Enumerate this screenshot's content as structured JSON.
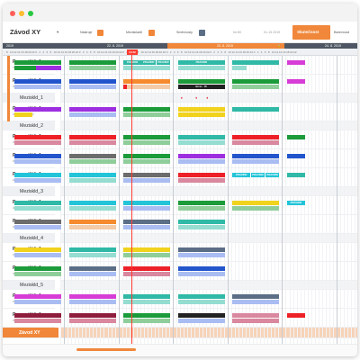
{
  "colors": {
    "accent": "#f0873a",
    "green": "#1b9b3a",
    "lightgreen": "#8fce9a",
    "blue": "#2255cc",
    "lightblue": "#a9bdf2",
    "purple": "#9d2fe0",
    "magenta": "#d63dd6",
    "teal": "#2fb9a6",
    "lightteal": "#95dcd1",
    "cyan": "#23c4d8",
    "red": "#ee2027",
    "yellow": "#f1d21d",
    "gray": "#6c6c6c",
    "slate": "#5b6e86",
    "maroon": "#8e1c3d",
    "pink": "#d9889f",
    "orange": "#f58b2e",
    "lightorange": "#f3cba8",
    "black": "#222222",
    "now": "#ff3b30"
  },
  "window": {
    "controls": [
      "close",
      "minimize",
      "zoom"
    ]
  },
  "toolbar": {
    "title": "Závod XY",
    "caret": "▾",
    "legend": [
      {
        "label": "Nástroje",
        "color": "#f0873a"
      },
      {
        "label": "Meziskladů",
        "color": "#f0873a"
      },
      {
        "label": "Směnnosty",
        "color": "#5b6e86"
      }
    ],
    "view_week": "Im:60",
    "view_range": "01-15 2019",
    "active_tab": "Skutečnost",
    "inactive_tab": "Barevnost"
  },
  "timeline": {
    "year": "2019",
    "dates": [
      "22. 8. 2019",
      "23. 8. 2019",
      "24. 8. 2019"
    ],
    "lock_icon": "🔒",
    "now_label": "14:42",
    "day_ticks": [
      "8",
      "10",
      "12",
      "14",
      "16",
      "18",
      "20",
      "22",
      "0",
      "2",
      "4",
      "6",
      "8",
      "10",
      "12",
      "14",
      "16",
      "18",
      "20",
      "22",
      "0",
      "2",
      "4",
      "6",
      "8",
      "10",
      "12",
      "14",
      "16",
      "18",
      "20",
      "22",
      "0",
      "2",
      "4",
      "6",
      "8",
      "10",
      "12",
      "14",
      "16",
      "18",
      "20",
      "22",
      "0",
      "2",
      "4",
      "6",
      "8",
      "10",
      "12",
      "14",
      "16",
      "18",
      "20",
      "22",
      "0",
      "2",
      "4",
      "6",
      "8",
      "10",
      "12",
      "14",
      "16",
      "18",
      "20",
      "22",
      "0",
      "2",
      "4",
      "6",
      "8",
      "10",
      "12",
      "14",
      "16",
      "18",
      "20",
      "22"
    ]
  },
  "rows": [
    {
      "name": "Pracoviště_1",
      "sub": "Motor 1 · Linka 4380",
      "type": "work",
      "accent": true
    },
    {
      "name": "Pracoviště_1",
      "sub": "Motor 1 · Linka 4380",
      "type": "work",
      "accent": true
    },
    {
      "name": "Meziskld_1",
      "sub": "",
      "type": "buffer",
      "accent": true
    },
    {
      "name": "Pracoviště_1",
      "sub": "Motor 1 · Linka 4380",
      "type": "work",
      "accent": true
    },
    {
      "name": "Meziskld_2",
      "sub": "",
      "type": "buffer",
      "accent": false
    },
    {
      "name": "Pracoviště_1",
      "sub": "Motor 1 · Linka 4380",
      "type": "work",
      "accent": false
    },
    {
      "name": "Pracoviště_1",
      "sub": "Motor 1 · Linka 4380",
      "type": "work",
      "accent": false
    },
    {
      "name": "Pracoviště_1",
      "sub": "Motor 1 · Linka 4380",
      "type": "work",
      "accent": false
    },
    {
      "name": "Meziskld_3",
      "sub": "",
      "type": "buffer",
      "accent": false
    },
    {
      "name": "Pracoviště_1",
      "sub": "Motor 1 · Linka 4380",
      "type": "work",
      "accent": false
    },
    {
      "name": "Pracoviště_1",
      "sub": "Motor 1 · Linka 4380",
      "type": "work",
      "accent": false
    },
    {
      "name": "Meziskld_4",
      "sub": "",
      "type": "buffer",
      "accent": false
    },
    {
      "name": "Pracoviště_1",
      "sub": "Motor 1 · Linka 4380",
      "type": "work",
      "accent": false
    },
    {
      "name": "Pracoviště_1",
      "sub": "Motor 1 · Linka 4380",
      "type": "work",
      "accent": false
    },
    {
      "name": "Meziskld_5",
      "sub": "",
      "type": "buffer",
      "accent": false
    },
    {
      "name": "Pracoviště_1",
      "sub": "Motor 1 · Linka 4380",
      "type": "work",
      "accent": false
    },
    {
      "name": "Pracoviště_1",
      "sub": "Motor 1 · Linka 4380",
      "type": "work",
      "accent": false
    },
    {
      "name": "Závod XY",
      "sub": "",
      "type": "plant",
      "accent": false
    }
  ],
  "bars": [
    {
      "row": 0,
      "start": 2,
      "end": 15,
      "lane": 0,
      "color": "green"
    },
    {
      "row": 0,
      "start": 2,
      "end": 8,
      "lane": 1,
      "color": "green"
    },
    {
      "row": 0,
      "start": 8,
      "end": 15,
      "lane": 1,
      "color": "purple"
    },
    {
      "row": 0,
      "start": 17,
      "end": 30,
      "lane": 0,
      "color": "green"
    },
    {
      "row": 0,
      "start": 17,
      "end": 30,
      "lane": 1,
      "color": "lightgreen"
    },
    {
      "row": 0,
      "start": 32,
      "end": 37,
      "lane": 0,
      "color": "teal",
      "label": "PRAVIDR"
    },
    {
      "row": 0,
      "start": 37,
      "end": 41,
      "lane": 0,
      "color": "teal",
      "label": "PRAVIDR"
    },
    {
      "row": 0,
      "start": 41,
      "end": 45,
      "lane": 0,
      "color": "teal",
      "label": "PRAVIDR"
    },
    {
      "row": 0,
      "start": 32,
      "end": 45,
      "lane": 1,
      "color": "lightteal"
    },
    {
      "row": 0,
      "start": 47,
      "end": 60,
      "lane": 0,
      "color": "teal",
      "label": "PRAVIDR"
    },
    {
      "row": 0,
      "start": 47,
      "end": 60,
      "lane": 1,
      "color": "lightteal"
    },
    {
      "row": 0,
      "start": 62,
      "end": 75,
      "lane": 0,
      "color": "teal"
    },
    {
      "row": 0,
      "start": 62,
      "end": 66,
      "lane": 1,
      "color": "lightteal"
    },
    {
      "row": 0,
      "start": 77,
      "end": 82,
      "lane": 0,
      "color": "magenta"
    },
    {
      "row": 1,
      "start": 2,
      "end": 15,
      "lane": 0,
      "color": "blue"
    },
    {
      "row": 1,
      "start": 2,
      "end": 15,
      "lane": 1,
      "color": "lightblue"
    },
    {
      "row": 1,
      "start": 17,
      "end": 30,
      "lane": 0,
      "color": "blue"
    },
    {
      "row": 1,
      "start": 17,
      "end": 30,
      "lane": 1,
      "color": "lightblue"
    },
    {
      "row": 1,
      "start": 32,
      "end": 45,
      "lane": 0,
      "color": "orange"
    },
    {
      "row": 1,
      "start": 32,
      "end": 33,
      "lane": 1,
      "color": "red"
    },
    {
      "row": 1,
      "start": 33,
      "end": 45,
      "lane": 1,
      "color": "lightorange"
    },
    {
      "row": 1,
      "start": 47,
      "end": 60,
      "lane": 0,
      "color": "green"
    },
    {
      "row": 1,
      "start": 47,
      "end": 60,
      "lane": 1,
      "color": "black",
      "label": "Error - 7h"
    },
    {
      "row": 1,
      "start": 62,
      "end": 75,
      "lane": 0,
      "color": "green"
    },
    {
      "row": 1,
      "start": 62,
      "end": 75,
      "lane": 1,
      "color": "lightgreen"
    },
    {
      "row": 1,
      "start": 77,
      "end": 82,
      "lane": 0,
      "color": "magenta"
    },
    {
      "row": 3,
      "start": 2,
      "end": 15,
      "lane": 0,
      "color": "purple"
    },
    {
      "row": 3,
      "start": 2,
      "end": 7,
      "lane": 1,
      "color": "yellow"
    },
    {
      "row": 3,
      "start": 17,
      "end": 30,
      "lane": 0,
      "color": "purple"
    },
    {
      "row": 3,
      "start": 17,
      "end": 30,
      "lane": 1,
      "color": "lightblue"
    },
    {
      "row": 3,
      "start": 32,
      "end": 45,
      "lane": 0,
      "color": "green"
    },
    {
      "row": 3,
      "start": 32,
      "end": 45,
      "lane": 1,
      "color": "lightgreen"
    },
    {
      "row": 3,
      "start": 47,
      "end": 60,
      "lane": 0,
      "color": "yellow"
    },
    {
      "row": 3,
      "start": 47,
      "end": 60,
      "lane": 1,
      "color": "yellow"
    },
    {
      "row": 3,
      "start": 62,
      "end": 75,
      "lane": 0,
      "color": "teal"
    },
    {
      "row": 5,
      "start": 2,
      "end": 15,
      "lane": 0,
      "color": "red"
    },
    {
      "row": 5,
      "start": 2,
      "end": 15,
      "lane": 1,
      "color": "pink"
    },
    {
      "row": 5,
      "start": 17,
      "end": 30,
      "lane": 0,
      "color": "red"
    },
    {
      "row": 5,
      "start": 17,
      "end": 30,
      "lane": 1,
      "color": "pink"
    },
    {
      "row": 5,
      "start": 32,
      "end": 45,
      "lane": 0,
      "color": "green"
    },
    {
      "row": 5,
      "start": 32,
      "end": 45,
      "lane": 1,
      "color": "lightgreen"
    },
    {
      "row": 5,
      "start": 47,
      "end": 60,
      "lane": 0,
      "color": "teal"
    },
    {
      "row": 5,
      "start": 47,
      "end": 60,
      "lane": 1,
      "color": "lightteal"
    },
    {
      "row": 5,
      "start": 62,
      "end": 75,
      "lane": 0,
      "color": "red"
    },
    {
      "row": 5,
      "start": 62,
      "end": 75,
      "lane": 1,
      "color": "pink"
    },
    {
      "row": 5,
      "start": 77,
      "end": 82,
      "lane": 0,
      "color": "green"
    },
    {
      "row": 6,
      "start": 2,
      "end": 15,
      "lane": 0,
      "color": "blue"
    },
    {
      "row": 6,
      "start": 2,
      "end": 15,
      "lane": 1,
      "color": "lightblue"
    },
    {
      "row": 6,
      "start": 17,
      "end": 30,
      "lane": 0,
      "color": "gray"
    },
    {
      "row": 6,
      "start": 17,
      "end": 30,
      "lane": 1,
      "color": "lightgreen"
    },
    {
      "row": 6,
      "start": 32,
      "end": 45,
      "lane": 0,
      "color": "green"
    },
    {
      "row": 6,
      "start": 32,
      "end": 45,
      "lane": 1,
      "color": "lightgreen"
    },
    {
      "row": 6,
      "start": 47,
      "end": 60,
      "lane": 0,
      "color": "purple"
    },
    {
      "row": 6,
      "start": 47,
      "end": 60,
      "lane": 1,
      "color": "lightblue"
    },
    {
      "row": 6,
      "start": 62,
      "end": 75,
      "lane": 0,
      "color": "blue"
    },
    {
      "row": 6,
      "start": 62,
      "end": 75,
      "lane": 1,
      "color": "lightblue"
    },
    {
      "row": 6,
      "start": 77,
      "end": 82,
      "lane": 0,
      "color": "blue"
    },
    {
      "row": 7,
      "start": 2,
      "end": 15,
      "lane": 0,
      "color": "cyan"
    },
    {
      "row": 7,
      "start": 2,
      "end": 15,
      "lane": 1,
      "color": "lightblue"
    },
    {
      "row": 7,
      "start": 17,
      "end": 30,
      "lane": 0,
      "color": "cyan"
    },
    {
      "row": 7,
      "start": 17,
      "end": 30,
      "lane": 1,
      "color": "lightteal"
    },
    {
      "row": 7,
      "start": 32,
      "end": 45,
      "lane": 0,
      "color": "gray"
    },
    {
      "row": 7,
      "start": 32,
      "end": 45,
      "lane": 1,
      "color": "lightblue"
    },
    {
      "row": 7,
      "start": 47,
      "end": 60,
      "lane": 0,
      "color": "red"
    },
    {
      "row": 7,
      "start": 47,
      "end": 60,
      "lane": 1,
      "color": "pink"
    },
    {
      "row": 7,
      "start": 62,
      "end": 67,
      "lane": 0,
      "color": "cyan",
      "label": "PRAVIDR"
    },
    {
      "row": 7,
      "start": 67,
      "end": 71,
      "lane": 0,
      "color": "cyan",
      "label": "PRAVIDR"
    },
    {
      "row": 7,
      "start": 71,
      "end": 75,
      "lane": 0,
      "color": "cyan",
      "label": "PRAVIDR"
    },
    {
      "row": 7,
      "start": 77,
      "end": 82,
      "lane": 0,
      "color": "teal"
    },
    {
      "row": 9,
      "start": 2,
      "end": 15,
      "lane": 0,
      "color": "teal"
    },
    {
      "row": 9,
      "start": 2,
      "end": 15,
      "lane": 1,
      "color": "lightteal"
    },
    {
      "row": 9,
      "start": 17,
      "end": 30,
      "lane": 0,
      "color": "cyan"
    },
    {
      "row": 9,
      "start": 17,
      "end": 30,
      "lane": 1,
      "color": "lightteal"
    },
    {
      "row": 9,
      "start": 32,
      "end": 45,
      "lane": 0,
      "color": "cyan"
    },
    {
      "row": 9,
      "start": 32,
      "end": 45,
      "lane": 1,
      "color": "lightblue"
    },
    {
      "row": 9,
      "start": 47,
      "end": 60,
      "lane": 0,
      "color": "green"
    },
    {
      "row": 9,
      "start": 47,
      "end": 60,
      "lane": 1,
      "color": "lightgreen"
    },
    {
      "row": 9,
      "start": 62,
      "end": 75,
      "lane": 0,
      "color": "yellow"
    },
    {
      "row": 9,
      "start": 62,
      "end": 75,
      "lane": 1,
      "color": "lightgreen"
    },
    {
      "row": 9,
      "start": 77,
      "end": 82,
      "lane": 0,
      "color": "cyan",
      "label": "PRAVIDR"
    },
    {
      "row": 10,
      "start": 2,
      "end": 15,
      "lane": 0,
      "color": "gray"
    },
    {
      "row": 10,
      "start": 2,
      "end": 15,
      "lane": 1,
      "color": "lightblue"
    },
    {
      "row": 10,
      "start": 17,
      "end": 30,
      "lane": 0,
      "color": "orange"
    },
    {
      "row": 10,
      "start": 17,
      "end": 30,
      "lane": 1,
      "color": "lightorange"
    },
    {
      "row": 10,
      "start": 32,
      "end": 45,
      "lane": 0,
      "color": "slate"
    },
    {
      "row": 10,
      "start": 32,
      "end": 45,
      "lane": 1,
      "color": "lightblue"
    },
    {
      "row": 10,
      "start": 47,
      "end": 60,
      "lane": 0,
      "color": "teal"
    },
    {
      "row": 10,
      "start": 47,
      "end": 60,
      "lane": 1,
      "color": "lightteal"
    },
    {
      "row": 12,
      "start": 2,
      "end": 15,
      "lane": 0,
      "color": "yellow"
    },
    {
      "row": 12,
      "start": 2,
      "end": 15,
      "lane": 1,
      "color": "lightblue"
    },
    {
      "row": 12,
      "start": 17,
      "end": 30,
      "lane": 0,
      "color": "teal"
    },
    {
      "row": 12,
      "start": 17,
      "end": 30,
      "lane": 1,
      "color": "lightteal"
    },
    {
      "row": 12,
      "start": 32,
      "end": 45,
      "lane": 0,
      "color": "yellow"
    },
    {
      "row": 12,
      "start": 32,
      "end": 45,
      "lane": 1,
      "color": "lightgreen"
    },
    {
      "row": 12,
      "start": 47,
      "end": 60,
      "lane": 0,
      "color": "slate"
    },
    {
      "row": 12,
      "start": 47,
      "end": 60,
      "lane": 1,
      "color": "lightblue"
    },
    {
      "row": 13,
      "start": 2,
      "end": 15,
      "lane": 0,
      "color": "green"
    },
    {
      "row": 13,
      "start": 2,
      "end": 15,
      "lane": 1,
      "color": "lightgreen"
    },
    {
      "row": 13,
      "start": 17,
      "end": 30,
      "lane": 0,
      "color": "slate"
    },
    {
      "row": 13,
      "start": 17,
      "end": 30,
      "lane": 1,
      "color": "lightblue"
    },
    {
      "row": 13,
      "start": 32,
      "end": 45,
      "lane": 0,
      "color": "red"
    },
    {
      "row": 13,
      "start": 32,
      "end": 45,
      "lane": 1,
      "color": "pink"
    },
    {
      "row": 13,
      "start": 47,
      "end": 60,
      "lane": 0,
      "color": "blue"
    },
    {
      "row": 13,
      "start": 47,
      "end": 60,
      "lane": 1,
      "color": "lightblue"
    },
    {
      "row": 15,
      "start": 2,
      "end": 15,
      "lane": 0,
      "color": "magenta"
    },
    {
      "row": 15,
      "start": 2,
      "end": 15,
      "lane": 1,
      "color": "lightblue"
    },
    {
      "row": 15,
      "start": 17,
      "end": 30,
      "lane": 0,
      "color": "magenta"
    },
    {
      "row": 15,
      "start": 17,
      "end": 30,
      "lane": 1,
      "color": "lightblue"
    },
    {
      "row": 15,
      "start": 32,
      "end": 45,
      "lane": 0,
      "color": "teal"
    },
    {
      "row": 15,
      "start": 32,
      "end": 45,
      "lane": 1,
      "color": "lightteal"
    },
    {
      "row": 15,
      "start": 47,
      "end": 60,
      "lane": 0,
      "color": "teal"
    },
    {
      "row": 15,
      "start": 47,
      "end": 60,
      "lane": 1,
      "color": "lightteal"
    },
    {
      "row": 15,
      "start": 62,
      "end": 75,
      "lane": 0,
      "color": "slate"
    },
    {
      "row": 15,
      "start": 62,
      "end": 75,
      "lane": 1,
      "color": "lightblue"
    },
    {
      "row": 16,
      "start": 2,
      "end": 15,
      "lane": 0,
      "color": "maroon"
    },
    {
      "row": 16,
      "start": 2,
      "end": 15,
      "lane": 1,
      "color": "pink"
    },
    {
      "row": 16,
      "start": 17,
      "end": 30,
      "lane": 0,
      "color": "maroon"
    },
    {
      "row": 16,
      "start": 17,
      "end": 30,
      "lane": 1,
      "color": "pink"
    },
    {
      "row": 16,
      "start": 32,
      "end": 45,
      "lane": 0,
      "color": "green"
    },
    {
      "row": 16,
      "start": 32,
      "end": 45,
      "lane": 1,
      "color": "lightgreen"
    },
    {
      "row": 16,
      "start": 47,
      "end": 60,
      "lane": 0,
      "color": "black"
    },
    {
      "row": 16,
      "start": 47,
      "end": 60,
      "lane": 1,
      "color": "lightblue"
    },
    {
      "row": 16,
      "start": 62,
      "end": 75,
      "lane": 0,
      "color": "pink"
    },
    {
      "row": 16,
      "start": 62,
      "end": 75,
      "lane": 1,
      "color": "pink"
    },
    {
      "row": 16,
      "start": 77,
      "end": 82,
      "lane": 0,
      "color": "red"
    }
  ],
  "alerts": [
    {
      "row": 2,
      "ticks": [
        48,
        52,
        55
      ],
      "symbol": "♦"
    }
  ]
}
